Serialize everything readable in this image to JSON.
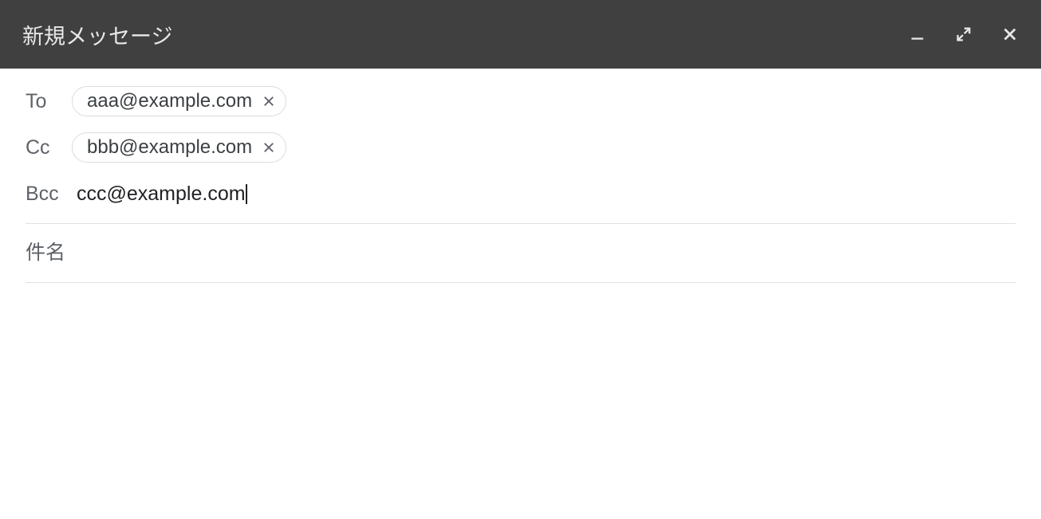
{
  "header": {
    "title": "新規メッセージ"
  },
  "recipients": {
    "to_label": "To",
    "to_chip": "aaa@example.com",
    "cc_label": "Cc",
    "cc_chip": "bbb@example.com",
    "bcc_label": "Bcc",
    "bcc_value": "ccc@example.com"
  },
  "subject": {
    "placeholder": "件名"
  }
}
